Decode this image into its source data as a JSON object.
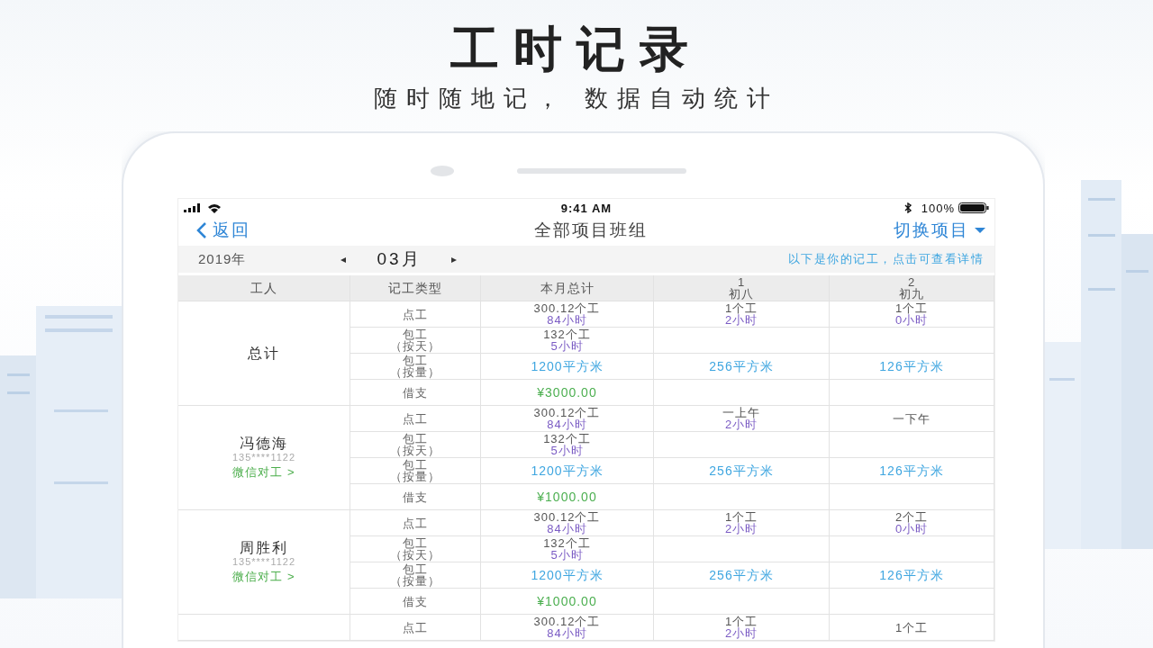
{
  "promo": {
    "title": "工时记录",
    "subtitle": "随时随地记， 数据自动统计"
  },
  "status_bar": {
    "time": "9:41 AM",
    "battery": "100%"
  },
  "nav_bar": {
    "back": "返回",
    "title": "全部项目班组",
    "switch": "切换项目"
  },
  "date_bar": {
    "year": "2019年",
    "prev": "◂",
    "month": "03月",
    "next": "▸",
    "hint": "以下是你的记工，点击可查看详情"
  },
  "table": {
    "columns": [
      {
        "label": "工人"
      },
      {
        "label": "记工类型"
      },
      {
        "label": "本月总计"
      },
      {
        "day": "1",
        "lunar": "初八"
      },
      {
        "day": "2",
        "lunar": "初九"
      }
    ],
    "groups": [
      {
        "worker": {
          "name": "总计"
        },
        "rows": [
          {
            "type": [
              "点工"
            ],
            "cells": [
              [
                {
                  "text": "300.12个工",
                  "kind": "count"
                },
                {
                  "text": "84小时",
                  "kind": "hours"
                }
              ],
              [
                {
                  "text": "1个工",
                  "kind": "count"
                },
                {
                  "text": "2小时",
                  "kind": "hours"
                }
              ],
              [
                {
                  "text": "1个工",
                  "kind": "count"
                },
                {
                  "text": "0小时",
                  "kind": "hours"
                }
              ]
            ]
          },
          {
            "type": [
              "包工",
              "（按天）"
            ],
            "cells": [
              [
                {
                  "text": "132个工",
                  "kind": "count"
                },
                {
                  "text": "5小时",
                  "kind": "hours"
                }
              ],
              [],
              []
            ]
          },
          {
            "type": [
              "包工",
              "（按量）"
            ],
            "cells": [
              [
                {
                  "text": "1200平方米",
                  "kind": "area"
                }
              ],
              [
                {
                  "text": "256平方米",
                  "kind": "area"
                }
              ],
              [
                {
                  "text": "126平方米",
                  "kind": "area"
                }
              ]
            ]
          },
          {
            "type": [
              "借支"
            ],
            "cells": [
              [
                {
                  "text": "¥3000.00",
                  "kind": "money"
                }
              ],
              [],
              []
            ]
          }
        ]
      },
      {
        "worker": {
          "name": "冯德海",
          "phone": "135****1122",
          "link": "微信对工 >"
        },
        "rows": [
          {
            "type": [
              "点工"
            ],
            "cells": [
              [
                {
                  "text": "300.12个工",
                  "kind": "count"
                },
                {
                  "text": "84小时",
                  "kind": "hours"
                }
              ],
              [
                {
                  "text": "一上午",
                  "kind": "count"
                },
                {
                  "text": "2小时",
                  "kind": "hours"
                }
              ],
              [
                {
                  "text": "一下午",
                  "kind": "count"
                }
              ]
            ]
          },
          {
            "type": [
              "包工",
              "（按天）"
            ],
            "cells": [
              [
                {
                  "text": "132个工",
                  "kind": "count"
                },
                {
                  "text": "5小时",
                  "kind": "hours"
                }
              ],
              [],
              []
            ]
          },
          {
            "type": [
              "包工",
              "（按量）"
            ],
            "cells": [
              [
                {
                  "text": "1200平方米",
                  "kind": "area"
                }
              ],
              [
                {
                  "text": "256平方米",
                  "kind": "area"
                }
              ],
              [
                {
                  "text": "126平方米",
                  "kind": "area"
                }
              ]
            ]
          },
          {
            "type": [
              "借支"
            ],
            "cells": [
              [
                {
                  "text": "¥1000.00",
                  "kind": "money"
                }
              ],
              [],
              []
            ]
          }
        ]
      },
      {
        "worker": {
          "name": "周胜利",
          "phone": "135****1122",
          "link": "微信对工 >"
        },
        "rows": [
          {
            "type": [
              "点工"
            ],
            "cells": [
              [
                {
                  "text": "300.12个工",
                  "kind": "count"
                },
                {
                  "text": "84小时",
                  "kind": "hours"
                }
              ],
              [
                {
                  "text": "1个工",
                  "kind": "count"
                },
                {
                  "text": "2小时",
                  "kind": "hours"
                }
              ],
              [
                {
                  "text": "2个工",
                  "kind": "count"
                },
                {
                  "text": "0小时",
                  "kind": "hours"
                }
              ]
            ]
          },
          {
            "type": [
              "包工",
              "（按天）"
            ],
            "cells": [
              [
                {
                  "text": "132个工",
                  "kind": "count"
                },
                {
                  "text": "5小时",
                  "kind": "hours"
                }
              ],
              [],
              []
            ]
          },
          {
            "type": [
              "包工",
              "（按量）"
            ],
            "cells": [
              [
                {
                  "text": "1200平方米",
                  "kind": "area"
                }
              ],
              [
                {
                  "text": "256平方米",
                  "kind": "area"
                }
              ],
              [
                {
                  "text": "126平方米",
                  "kind": "area"
                }
              ]
            ]
          },
          {
            "type": [
              "借支"
            ],
            "cells": [
              [
                {
                  "text": "¥1000.00",
                  "kind": "money"
                }
              ],
              [],
              []
            ]
          }
        ]
      },
      {
        "rows": [
          {
            "type": [
              "点工"
            ],
            "cells": [
              [
                {
                  "text": "300.12个工",
                  "kind": "count"
                },
                {
                  "text": "84小时",
                  "kind": "hours"
                }
              ],
              [
                {
                  "text": "1个工",
                  "kind": "count"
                },
                {
                  "text": "2小时",
                  "kind": "hours"
                }
              ],
              [
                {
                  "text": "1个工",
                  "kind": "count"
                }
              ]
            ]
          }
        ]
      }
    ]
  }
}
